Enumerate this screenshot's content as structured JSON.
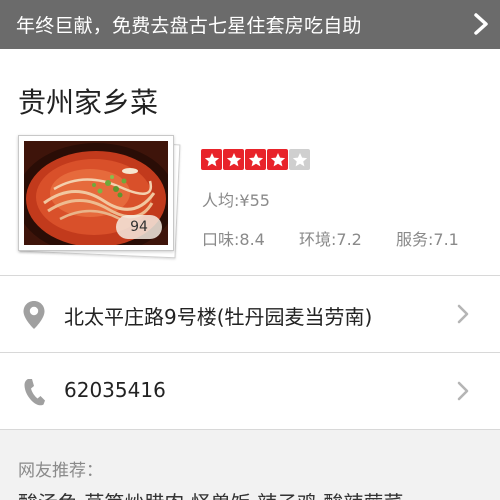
{
  "banner": {
    "text": "年终巨献，免费去盘古七星住套房吃自助",
    "arrow_icon": "chevron-right-icon"
  },
  "shop": {
    "name": "贵州家乡菜",
    "photo_count": "94",
    "rating": 4,
    "rating_max": 5,
    "avg_price": "人均:¥55",
    "scores": {
      "taste": "口味:8.4",
      "environment": "环境:7.2",
      "service": "服务:7.1"
    }
  },
  "address": {
    "text": "北太平庄路9号楼(牡丹园麦当劳南)",
    "icon": "location-pin-icon"
  },
  "phone": {
    "text": "62035416",
    "icon": "phone-icon"
  },
  "recommend": {
    "label": "网友推荐：",
    "dishes": "酸汤鱼 莴笋炒腊肉 怪兽饭 辣子鸡 酸辣蕨菜"
  },
  "colors": {
    "banner_bg": "#6b6b6b",
    "star_on": "#e8232a",
    "star_off": "#cfcfcf",
    "secondary_text": "#8a8a8a"
  }
}
